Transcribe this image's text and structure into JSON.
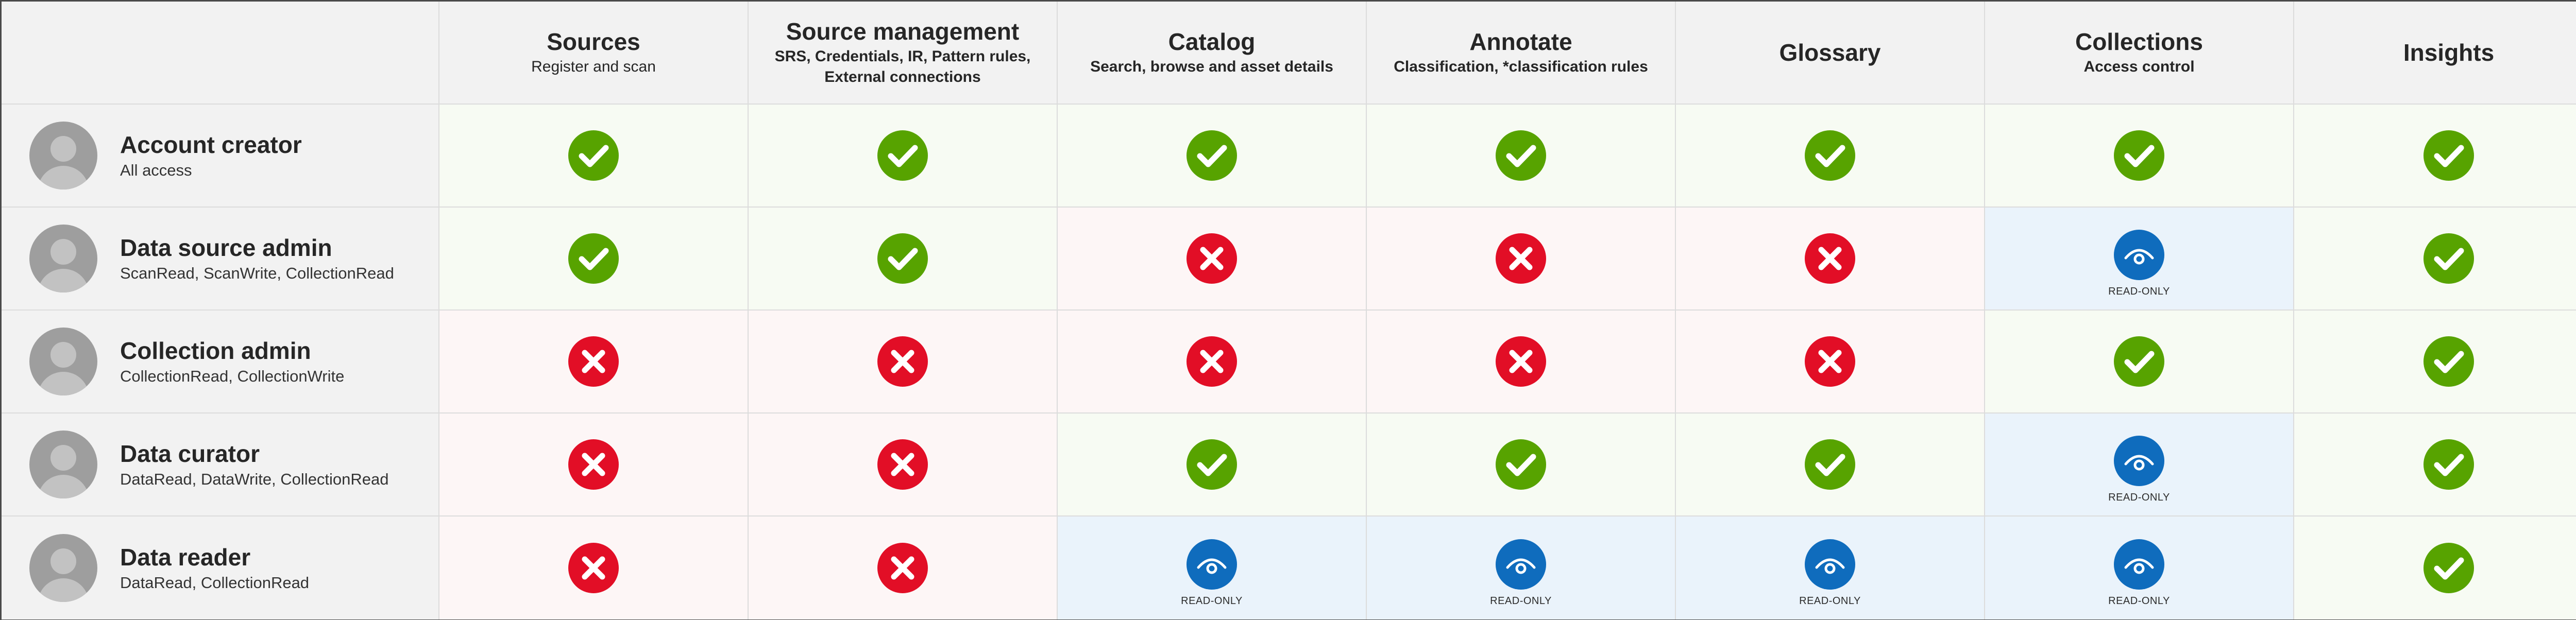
{
  "columns": [
    {
      "title": "Sources",
      "subtitle": "Register and scan",
      "subtitle_bold": false
    },
    {
      "title": "Source management",
      "subtitle": "SRS, Credentials, IR, Pattern rules, External connections",
      "subtitle_bold": true
    },
    {
      "title": "Catalog",
      "subtitle": "Search, browse and asset details",
      "subtitle_bold": true
    },
    {
      "title": "Annotate",
      "subtitle": "Classification, *classification rules",
      "subtitle_bold": true
    },
    {
      "title": "Glossary",
      "subtitle": "",
      "subtitle_bold": true
    },
    {
      "title": "Collections",
      "subtitle": "Access control",
      "subtitle_bold": true
    },
    {
      "title": "Insights",
      "subtitle": "",
      "subtitle_bold": true
    }
  ],
  "roles": [
    {
      "name": "Account creator",
      "permissions": "All access",
      "access": [
        "yes",
        "yes",
        "yes",
        "yes",
        "yes",
        "yes",
        "yes"
      ]
    },
    {
      "name": "Data source admin",
      "permissions": "ScanRead, ScanWrite, CollectionRead",
      "access": [
        "yes",
        "yes",
        "no",
        "no",
        "no",
        "readonly",
        "yes"
      ]
    },
    {
      "name": "Collection admin",
      "permissions": "CollectionRead, CollectionWrite",
      "access": [
        "no",
        "no",
        "no",
        "no",
        "no",
        "yes",
        "yes"
      ]
    },
    {
      "name": "Data curator",
      "permissions": "DataRead, DataWrite, CollectionRead",
      "access": [
        "no",
        "no",
        "yes",
        "yes",
        "yes",
        "readonly",
        "yes"
      ]
    },
    {
      "name": "Data reader",
      "permissions": "DataRead, CollectionRead",
      "access": [
        "no",
        "no",
        "readonly",
        "readonly",
        "readonly",
        "readonly",
        "yes"
      ]
    }
  ],
  "readonly_label": "READ-ONLY",
  "icons": {
    "yes": "check-icon",
    "no": "cross-icon",
    "readonly": "eye-icon",
    "avatar": "user-avatar-icon"
  },
  "colors": {
    "yes": "#57a300",
    "no": "#e20e26",
    "readonly": "#0f6cbd",
    "header_bg": "#f2f2f2",
    "yes_bg": "#f7fbf3",
    "no_bg": "#fdf6f6",
    "readonly_bg": "#eaf3fb"
  }
}
